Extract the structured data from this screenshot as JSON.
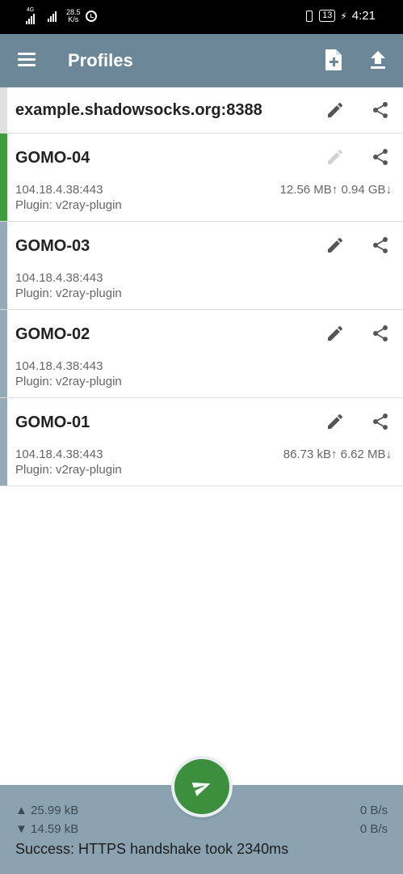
{
  "status_bar": {
    "net1": "4G",
    "speed_value": "28.5",
    "speed_unit": "K/s",
    "battery": "13",
    "time": "4:21"
  },
  "app_bar": {
    "title": "Profiles"
  },
  "main_server": {
    "title": "example.shadowsocks.org:8388"
  },
  "profiles": [
    {
      "name": "GOMO-04",
      "address": "104.18.4.38:443",
      "plugin": "Plugin: v2ray-plugin",
      "traffic": "12.56 MB↑  0.94 GB↓",
      "active": true
    },
    {
      "name": "GOMO-03",
      "address": "104.18.4.38:443",
      "plugin": "Plugin: v2ray-plugin",
      "traffic": "",
      "active": false
    },
    {
      "name": "GOMO-02",
      "address": "104.18.4.38:443",
      "plugin": "Plugin: v2ray-plugin",
      "traffic": "",
      "active": false
    },
    {
      "name": "GOMO-01",
      "address": "104.18.4.38:443",
      "plugin": "Plugin: v2ray-plugin",
      "traffic": "86.73 kB↑  6.62 MB↓",
      "active": false
    }
  ],
  "bottom_panel": {
    "upload_total": "▲ 25.99 kB",
    "download_total": "▼ 14.59 kB",
    "upload_rate": "0 B/s",
    "download_rate": "0 B/s",
    "status": "Success: HTTPS handshake took 2340ms"
  },
  "colors": {
    "app_bar": "#6b8798",
    "active_indicator": "#3e9b3e",
    "inactive_indicator": "#95aab8",
    "fab": "#3c8f3c",
    "bottom_panel": "#8ba3b1"
  },
  "icons": [
    "menu-icon",
    "add-file-icon",
    "upload-icon",
    "edit-icon",
    "share-icon",
    "send-icon",
    "alarm-icon",
    "vibrate-icon",
    "battery-icon",
    "signal-icon"
  ]
}
